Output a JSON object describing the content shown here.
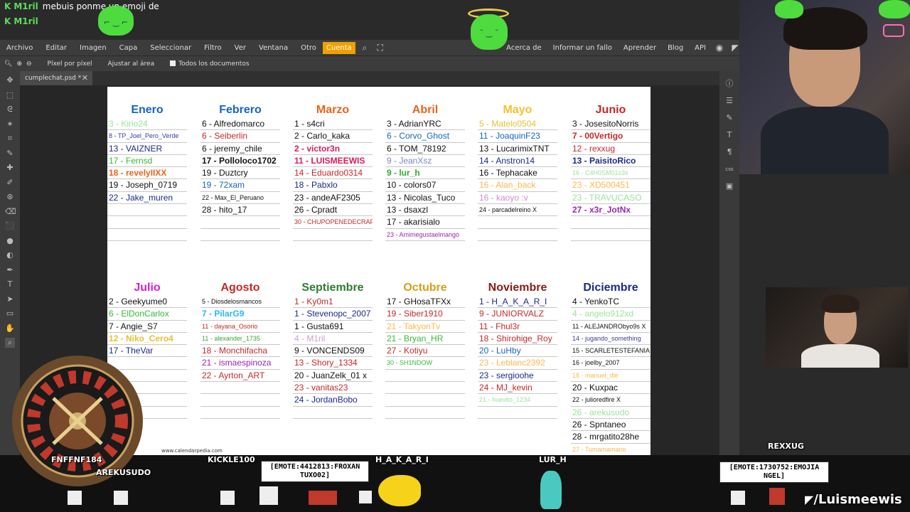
{
  "chat": {
    "lines": [
      {
        "user": "M1ril",
        "text": "mebuis ponme un emoji de"
      },
      {
        "user": "M1ril",
        "text": ""
      }
    ]
  },
  "menu": {
    "items": [
      "Archivo",
      "Editar",
      "Imagen",
      "Capa",
      "Seleccionar",
      "Filtro",
      "Ver",
      "Ventana",
      "Otro",
      "Cuenta"
    ],
    "right_items": [
      "Acerca de",
      "Informar un fallo",
      "Aprender",
      "Blog",
      "API"
    ]
  },
  "options": {
    "pixel": "Píxel por píxel",
    "fit": "Ajustar al área",
    "all_docs": "Todos los documentos"
  },
  "tab": {
    "name": "cumplechat.psd *"
  },
  "calendar": {
    "months": [
      {
        "name": "Enero",
        "color": "#1565c0",
        "entries": [
          {
            "t": "3 - Kirio24",
            "c": "#9be39b"
          },
          {
            "t": "8 - TP_Joel_Pero_Verde",
            "c": "#3a3aa8",
            "s": 1
          },
          {
            "t": "13 - VAIZNER",
            "c": "#1a2a8a"
          },
          {
            "t": "17 - Fernsd",
            "c": "#33bb33"
          },
          {
            "t": "18 - revelyIIXX",
            "c": "#e8641a",
            "b": 1
          },
          {
            "t": "19 - Joseph_0719",
            "c": "#111"
          },
          {
            "t": "22 - Jake_muren",
            "c": "#1a2a8a"
          },
          {
            "t": "",
            "c": "#111"
          },
          {
            "t": "",
            "c": "#111"
          },
          {
            "t": "",
            "c": "#111"
          }
        ]
      },
      {
        "name": "Febrero",
        "color": "#1565c0",
        "entries": [
          {
            "t": "6 - Alfredomarco",
            "c": "#111"
          },
          {
            "t": "6 - Seiberlin",
            "c": "#c62828"
          },
          {
            "t": "6 - jeremy_chile",
            "c": "#111"
          },
          {
            "t": "17 - Polloloco1702",
            "c": "#111",
            "b": 1
          },
          {
            "t": "19 - Duztcry",
            "c": "#111"
          },
          {
            "t": "19 - 72xam",
            "c": "#1565c0"
          },
          {
            "t": "22 - Max_El_Peruano",
            "c": "#111",
            "s": 1
          },
          {
            "t": "28 - hito_17",
            "c": "#111"
          },
          {
            "t": "",
            "c": "#111"
          },
          {
            "t": "",
            "c": "#111"
          }
        ]
      },
      {
        "name": "Marzo",
        "color": "#e8641a",
        "entries": [
          {
            "t": "1 - s4cri",
            "c": "#111"
          },
          {
            "t": "2 - Carlo_kaka",
            "c": "#111"
          },
          {
            "t": "2 - victor3n",
            "c": "#d81b60",
            "b": 1
          },
          {
            "t": "11 - LUISMEEWIS",
            "c": "#d81b60",
            "b": 1
          },
          {
            "t": "14 - Eduardo0314",
            "c": "#c62828"
          },
          {
            "t": "18 - Pabxlo",
            "c": "#1a2a8a"
          },
          {
            "t": "23 - andeAF2305",
            "c": "#111"
          },
          {
            "t": "26 - Cpradt",
            "c": "#111"
          },
          {
            "t": "30 - CHUPOPENEDECRAFT",
            "c": "#c62828",
            "s": 1
          },
          {
            "t": "",
            "c": "#111"
          }
        ]
      },
      {
        "name": "Abril",
        "color": "#e8641a",
        "entries": [
          {
            "t": "3 - AdrianYRC",
            "c": "#111"
          },
          {
            "t": "6 - Corvo_Ghost",
            "c": "#1565c0"
          },
          {
            "t": "6 - TOM_78192",
            "c": "#111"
          },
          {
            "t": "9 - JeanXsz",
            "c": "#7986cb"
          },
          {
            "t": "9 - lur_h",
            "c": "#33aa33",
            "b": 1
          },
          {
            "t": "10 - colors07",
            "c": "#111"
          },
          {
            "t": "13 - Nicolas_Tuco",
            "c": "#111"
          },
          {
            "t": "13 - dsaxzl",
            "c": "#111"
          },
          {
            "t": "17 - akarisialo",
            "c": "#111"
          },
          {
            "t": "23 - Amimegustaelmango",
            "c": "#9c27b0",
            "s": 1
          }
        ]
      },
      {
        "name": "Mayo",
        "color": "#f2c230",
        "entries": [
          {
            "t": "5 - Matelo0504",
            "c": "#e8c030"
          },
          {
            "t": "11 - JoaquinF23",
            "c": "#1565c0"
          },
          {
            "t": "13 - LucarimixTNT",
            "c": "#111"
          },
          {
            "t": "14 - Anstron14",
            "c": "#1a2a8a"
          },
          {
            "t": "16 - Tephacake",
            "c": "#111"
          },
          {
            "t": "16 - Alan_back",
            "c": "#ffb74d"
          },
          {
            "t": "16 - kaoyo :v",
            "c": "#d58bd5"
          },
          {
            "t": "24 - parcadelreino X",
            "c": "#111",
            "s": 1
          },
          {
            "t": "",
            "c": "#111"
          },
          {
            "t": "",
            "c": "#111"
          }
        ]
      },
      {
        "name": "Junio",
        "color": "#c62828",
        "entries": [
          {
            "t": "3 - JosesitoNorris",
            "c": "#111"
          },
          {
            "t": "7 - 00Vertigo",
            "c": "#c62828",
            "b": 1
          },
          {
            "t": "12 - rexxug",
            "c": "#c62828"
          },
          {
            "t": "13 - PaisitoRico",
            "c": "#1a2a8a",
            "b": 1
          },
          {
            "t": "16 - C4H0SM01s3s",
            "c": "#9be39b",
            "s": 1
          },
          {
            "t": "23 - XD500451",
            "c": "#ffb74d"
          },
          {
            "t": "23 - TRAVUCASO",
            "c": "#9be39b"
          },
          {
            "t": "27 - x3r_JotNx",
            "c": "#9c27b0",
            "b": 1
          },
          {
            "t": "",
            "c": "#111"
          },
          {
            "t": "",
            "c": "#111"
          }
        ]
      },
      {
        "name": "Julio",
        "color": "#d81bd8",
        "entries": [
          {
            "t": "2 - Geekyume0",
            "c": "#111"
          },
          {
            "t": "6 - ElDonCarlox",
            "c": "#33bb33"
          },
          {
            "t": "7 - Angie_S7",
            "c": "#111"
          },
          {
            "t": "12 - Niko_Cero4",
            "c": "#e8c030",
            "b": 1
          },
          {
            "t": "17 - TheVar",
            "c": "#1a2a8a"
          },
          {
            "t": "",
            "c": "#c62828"
          },
          {
            "t": "",
            "c": "#9c27b0"
          },
          {
            "t": "",
            "c": "#1565c0"
          },
          {
            "t": "",
            "c": "#111"
          },
          {
            "t": "",
            "c": "#111"
          }
        ]
      },
      {
        "name": "Agosto",
        "color": "#c62828",
        "entries": [
          {
            "t": "5 - Diosdelosmancos",
            "c": "#111",
            "s": 1
          },
          {
            "t": "7 - PilarG9",
            "c": "#29b6f6",
            "b": 1
          },
          {
            "t": "11 - dayana_Osorio",
            "c": "#c62828",
            "s": 1
          },
          {
            "t": "11 - alexander_1735",
            "c": "#33aa33",
            "s": 1
          },
          {
            "t": "18 - Monchifacha",
            "c": "#c62828"
          },
          {
            "t": "21 - ismaespinoza",
            "c": "#9c27b0"
          },
          {
            "t": "22 - Ayrton_ART",
            "c": "#c62828"
          },
          {
            "t": "",
            "c": "#111"
          },
          {
            "t": "",
            "c": "#111"
          },
          {
            "t": "",
            "c": "#111"
          }
        ]
      },
      {
        "name": "Septiembre",
        "color": "#2e7d32",
        "entries": [
          {
            "t": "1 - Ky0m1",
            "c": "#c62828"
          },
          {
            "t": "1 - Stevenopc_2007",
            "c": "#1a2a8a"
          },
          {
            "t": "1 - Gusta691",
            "c": "#111"
          },
          {
            "t": "4 - M1ril",
            "c": "#c8a0d8"
          },
          {
            "t": "9 - VONCENDS09",
            "c": "#111"
          },
          {
            "t": "13 - Shory_1334",
            "c": "#c62828"
          },
          {
            "t": "20 - JuanZelk_01 x",
            "c": "#111"
          },
          {
            "t": "23 - vanitas23",
            "c": "#c62828"
          },
          {
            "t": "24 - JordanBobo",
            "c": "#1a2a8a"
          },
          {
            "t": "",
            "c": "#111"
          }
        ]
      },
      {
        "name": "Octubre",
        "color": "#d4a017",
        "entries": [
          {
            "t": "17 - GHosaTFXx",
            "c": "#111"
          },
          {
            "t": "19 - Siber1910",
            "c": "#c62828"
          },
          {
            "t": "21 - TakyonTv",
            "c": "#ffb74d"
          },
          {
            "t": "21 - Bryan_HR",
            "c": "#33bb33"
          },
          {
            "t": "27 - Kotiyu",
            "c": "#c62828"
          },
          {
            "t": "30 - SH1NDOW",
            "c": "#33bb33",
            "s": 1
          },
          {
            "t": "",
            "c": "#111"
          },
          {
            "t": "",
            "c": "#111"
          },
          {
            "t": "",
            "c": "#111"
          },
          {
            "t": "",
            "c": "#111"
          }
        ]
      },
      {
        "name": "Noviembre",
        "color": "#8b1a1a",
        "entries": [
          {
            "t": "1 - H_A_K_A_R_I",
            "c": "#1a2a8a"
          },
          {
            "t": "9 - JUNIORVALZ",
            "c": "#c62828"
          },
          {
            "t": "11 - Fhul3r",
            "c": "#c62828"
          },
          {
            "t": "18 - Shirohige_Roy",
            "c": "#c62828"
          },
          {
            "t": "20 - LuHby",
            "c": "#1565c0"
          },
          {
            "t": "23 - Leblanc2392",
            "c": "#ffb74d"
          },
          {
            "t": "23 - sergioohe",
            "c": "#1a2a8a"
          },
          {
            "t": "24 - MJ_kevin",
            "c": "#c62828"
          },
          {
            "t": "21 - huevito_1234",
            "c": "#9be39b",
            "s": 1
          },
          {
            "t": "",
            "c": "#111"
          }
        ]
      },
      {
        "name": "Diciembre",
        "color": "#1a2a8a",
        "entries": [
          {
            "t": "4 - YenkoTC",
            "c": "#111"
          },
          {
            "t": "4 - angelo912xd",
            "c": "#9be39b"
          },
          {
            "t": "11 - ALEJANDRObyo9s X",
            "c": "#111",
            "s": 1
          },
          {
            "t": "14 - jugando_something",
            "c": "#3a3aa8",
            "s": 1
          },
          {
            "t": "15 - SCARLETESTEFANIA",
            "c": "#111",
            "s": 1
          },
          {
            "t": "16 - joelby_2007",
            "c": "#111",
            "s": 1
          },
          {
            "t": "18 - manuel_dle",
            "c": "#ffb74d",
            "s": 1
          },
          {
            "t": "20 - Kuxpac",
            "c": "#111"
          },
          {
            "t": "22 - julioredfire X",
            "c": "#111",
            "s": 1
          },
          {
            "t": "26 - arekusudo",
            "c": "#9be39b"
          },
          {
            "t": "26 - Spntaneo",
            "c": "#111"
          },
          {
            "t": "28 - mrgatito28he",
            "c": "#111"
          },
          {
            "t": "27 - Tumamamano",
            "c": "#ffb74d",
            "s": 1
          }
        ]
      }
    ],
    "footer": "www.calendarpedia.com"
  },
  "overlay": {
    "names": [
      "FNFFNF184",
      "AREKUSUDO",
      "KICKLE100",
      "H_A_K_A_R_I",
      "LUR_H",
      "REXXUG"
    ],
    "bubble1": "[EMOTE:4412813:FROXAN TUXO02]",
    "bubble2": "[EMOTE:1730752:EMOJIA NGEL]",
    "handle": "/Luismeewis"
  }
}
